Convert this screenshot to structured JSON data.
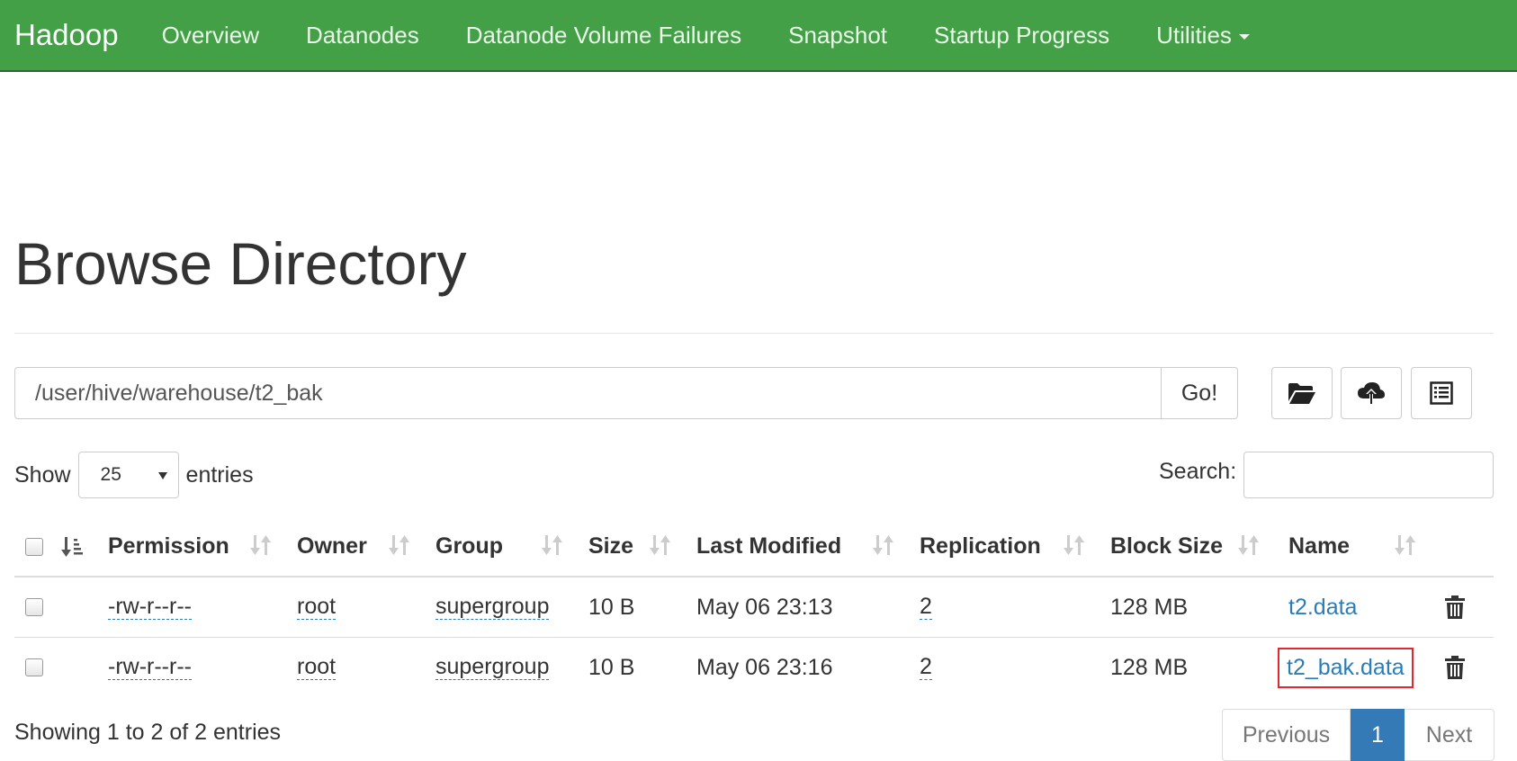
{
  "navbar": {
    "brand": "Hadoop",
    "items": [
      "Overview",
      "Datanodes",
      "Datanode Volume Failures",
      "Snapshot",
      "Startup Progress",
      "Utilities"
    ]
  },
  "page": {
    "title": "Browse Directory"
  },
  "path": {
    "value": "/user/hive/warehouse/t2_bak",
    "go_label": "Go!"
  },
  "toolbar": {
    "icons": [
      "folder-open-icon",
      "cloud-upload-icon",
      "list-icon"
    ]
  },
  "table_controls": {
    "show_label": "Show",
    "entries_value": "25",
    "entries_label": "entries",
    "search_label": "Search:"
  },
  "table": {
    "columns": [
      "Permission",
      "Owner",
      "Group",
      "Size",
      "Last Modified",
      "Replication",
      "Block Size",
      "Name"
    ],
    "rows": [
      {
        "permission": "-rw-r--r--",
        "owner": "root",
        "group": "supergroup",
        "size": "10 B",
        "modified": "May 06 23:13",
        "replication": "2",
        "block_size": "128 MB",
        "name": "t2.data"
      },
      {
        "permission": "-rw-r--r--",
        "owner": "root",
        "group": "supergroup",
        "size": "10 B",
        "modified": "May 06 23:16",
        "replication": "2",
        "block_size": "128 MB",
        "name": "t2_bak.data"
      }
    ]
  },
  "footer": {
    "showing": "Showing 1 to 2 of 2 entries",
    "prev": "Previous",
    "current": "1",
    "next": "Next"
  },
  "colors": {
    "navbar": "#43a047",
    "link": "#2a7db8",
    "active_page": "#337ab7",
    "highlight": "#e0282e"
  }
}
